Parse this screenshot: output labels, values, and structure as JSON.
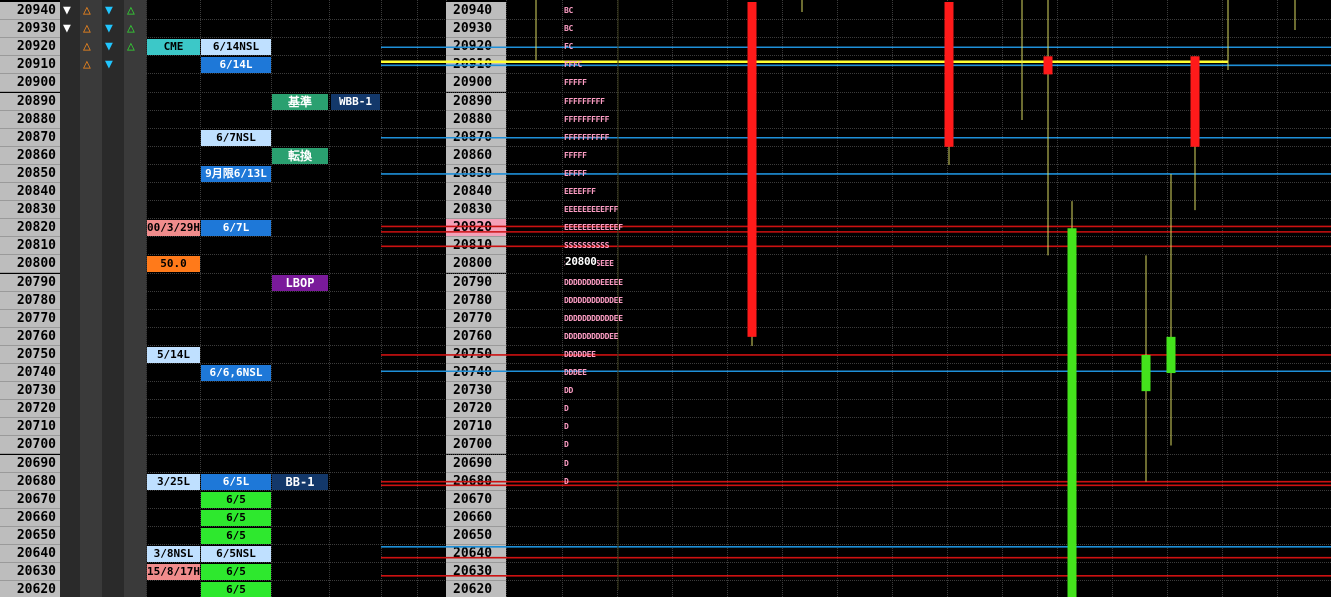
{
  "chart_data": {
    "type": "candlestick",
    "price_levels": [
      20940,
      20930,
      20920,
      20910,
      20900,
      20890,
      20880,
      20870,
      20860,
      20850,
      20840,
      20830,
      20820,
      20810,
      20800,
      20790,
      20780,
      20770,
      20760,
      20750,
      20740,
      20730,
      20720,
      20710,
      20700,
      20690,
      20680,
      20670,
      20660,
      20650,
      20640,
      20630,
      20620
    ],
    "ylim": [
      20615,
      20945
    ],
    "candles": [
      {
        "x_index": 0,
        "open": 20945,
        "close": 20760,
        "high": 20945,
        "low": 20755,
        "color": "red"
      },
      {
        "x_index": 1,
        "open": 20945,
        "close": 20865,
        "high": 20945,
        "low": 20855,
        "color": "red"
      },
      {
        "x_index": 2,
        "open": 20915,
        "close": 20905,
        "high": 20945,
        "low": 20805,
        "color": "red"
      },
      {
        "x_index": 3,
        "open": 20615,
        "close": 20820,
        "high": 20835,
        "low": 20615,
        "color": "green"
      },
      {
        "x_index": 4,
        "open": 20730,
        "close": 20750,
        "high": 20805,
        "low": 20680,
        "color": "green"
      },
      {
        "x_index": 5,
        "open": 20740,
        "close": 20760,
        "high": 20850,
        "low": 20700,
        "color": "green"
      },
      {
        "x_index": 6,
        "open": 20915,
        "close": 20865,
        "high": 20915,
        "low": 20830,
        "color": "red"
      }
    ],
    "horizontal_lines": [
      {
        "price": 20920,
        "color": "#1e8fd8"
      },
      {
        "price": 20912,
        "color": "#ffff33"
      },
      {
        "price": 20910,
        "color": "#1e8fd8"
      },
      {
        "price": 20870,
        "color": "#1e8fd8"
      },
      {
        "price": 20850,
        "color": "#1e8fd8"
      },
      {
        "price": 20821,
        "color": "#cc1111"
      },
      {
        "price": 20818,
        "color": "#cc1111"
      },
      {
        "price": 20810,
        "color": "#cc1111"
      },
      {
        "price": 20750,
        "color": "#cc1111"
      },
      {
        "price": 20741,
        "color": "#1e8fd8"
      },
      {
        "price": 20680,
        "color": "#cc1111"
      },
      {
        "price": 20678,
        "color": "#cc1111"
      },
      {
        "price": 20644,
        "color": "#1e8fd8"
      },
      {
        "price": 20638,
        "color": "#cc1111"
      },
      {
        "price": 20628,
        "color": "#cc1111"
      }
    ],
    "tpo_profile": [
      {
        "price": 20940,
        "letters": "BC"
      },
      {
        "price": 20930,
        "letters": "BC"
      },
      {
        "price": 20920,
        "letters": "FC"
      },
      {
        "price": 20910,
        "letters": "FFFC"
      },
      {
        "price": 20900,
        "letters": "FFFFF"
      },
      {
        "price": 20890,
        "letters": "FFFFFFFFF"
      },
      {
        "price": 20880,
        "letters": "FFFFFFFFFF"
      },
      {
        "price": 20870,
        "letters": "FFFFFFFFFF"
      },
      {
        "price": 20860,
        "letters": "FFFFF"
      },
      {
        "price": 20850,
        "letters": "EFFFF"
      },
      {
        "price": 20840,
        "letters": "EEEEFFF"
      },
      {
        "price": 20830,
        "letters": "EEEEEEEEEFFF"
      },
      {
        "price": 20820,
        "letters": "EEEEEEEEEEEEF"
      },
      {
        "price": 20810,
        "letters": "SSSSSSSSSS"
      },
      {
        "price": 20800,
        "letters": "SSSSSSSSEEE"
      },
      {
        "price": 20790,
        "letters": "DDDDDDDDEEEEE"
      },
      {
        "price": 20780,
        "letters": "DDDDDDDDDDDEE"
      },
      {
        "price": 20770,
        "letters": "DDDDDDDDDDDEE"
      },
      {
        "price": 20760,
        "letters": "DDDDDDDDDDEE"
      },
      {
        "price": 20750,
        "letters": "DDDDDEE"
      },
      {
        "price": 20740,
        "letters": "DDDEE"
      },
      {
        "price": 20730,
        "letters": "DD"
      },
      {
        "price": 20720,
        "letters": "D"
      },
      {
        "price": 20710,
        "letters": "D"
      },
      {
        "price": 20700,
        "letters": "D"
      },
      {
        "price": 20690,
        "letters": "D"
      },
      {
        "price": 20680,
        "letters": "D"
      }
    ],
    "tpo_highlight": {
      "price": 20800,
      "label": "20800"
    }
  },
  "arrows": [
    {
      "price": 20940,
      "col": 0,
      "glyph": "▼",
      "color": "#ffffff"
    },
    {
      "price": 20940,
      "col": 1,
      "glyph": "△",
      "color": "#ff8c1a"
    },
    {
      "price": 20940,
      "col": 2,
      "glyph": "▼",
      "color": "#21c6ff"
    },
    {
      "price": 20940,
      "col": 3,
      "glyph": "△",
      "color": "#33dd33"
    },
    {
      "price": 20930,
      "col": 0,
      "glyph": "▼",
      "color": "#ffffff"
    },
    {
      "price": 20930,
      "col": 1,
      "glyph": "△",
      "color": "#ff8c1a"
    },
    {
      "price": 20930,
      "col": 2,
      "glyph": "▼",
      "color": "#21c6ff"
    },
    {
      "price": 20930,
      "col": 3,
      "glyph": "△",
      "color": "#33dd33"
    },
    {
      "price": 20920,
      "col": 1,
      "glyph": "△",
      "color": "#ff8c1a"
    },
    {
      "price": 20920,
      "col": 2,
      "glyph": "▼",
      "color": "#21c6ff"
    },
    {
      "price": 20920,
      "col": 3,
      "glyph": "△",
      "color": "#33dd33"
    },
    {
      "price": 20910,
      "col": 1,
      "glyph": "△",
      "color": "#ff8c1a"
    },
    {
      "price": 20910,
      "col": 2,
      "glyph": "▼",
      "color": "#21c6ff"
    }
  ],
  "markers": [
    {
      "price": 20920,
      "col": "a",
      "text": "CME",
      "bg": "#3cc8c8",
      "fg": "#000000"
    },
    {
      "price": 20920,
      "col": "b",
      "text": "6/14NSL",
      "bg": "#bfe0ff",
      "fg": "#000000"
    },
    {
      "price": 20910,
      "col": "b",
      "text": "6/14L",
      "bg": "#1e78d8",
      "fg": "#ffffff"
    },
    {
      "price": 20890,
      "col": "c",
      "text": "基準",
      "bg": "#2aa070",
      "fg": "#ffffff"
    },
    {
      "price": 20890,
      "col": "d",
      "text": "WBB-1",
      "bg": "#13386a",
      "fg": "#ffffff"
    },
    {
      "price": 20870,
      "col": "b",
      "text": "6/7NSL",
      "bg": "#bfe0ff",
      "fg": "#000000"
    },
    {
      "price": 20860,
      "col": "c",
      "text": "転換",
      "bg": "#2aa070",
      "fg": "#ffffff"
    },
    {
      "price": 20850,
      "col": "b",
      "text": "9月限6/13L",
      "bg": "#1e78d8",
      "fg": "#ffffff"
    },
    {
      "price": 20820,
      "col": "a",
      "text": "00/3/29H",
      "bg": "#f08c8c",
      "fg": "#000000"
    },
    {
      "price": 20820,
      "col": "b",
      "text": "6/7L",
      "bg": "#1e78d8",
      "fg": "#ffffff"
    },
    {
      "price": 20800,
      "col": "a",
      "text": "50.0",
      "bg": "#ff7a1a",
      "fg": "#000000"
    },
    {
      "price": 20790,
      "col": "c",
      "text": "LBOP",
      "bg": "#7a1a9a",
      "fg": "#ffffff"
    },
    {
      "price": 20750,
      "col": "a",
      "text": "5/14L",
      "bg": "#bfe0ff",
      "fg": "#000000"
    },
    {
      "price": 20740,
      "col": "b",
      "text": "6/6,6NSL",
      "bg": "#1e78d8",
      "fg": "#ffffff"
    },
    {
      "price": 20680,
      "col": "a",
      "text": "3/25L",
      "bg": "#bfe0ff",
      "fg": "#000000"
    },
    {
      "price": 20680,
      "col": "b",
      "text": "6/5L",
      "bg": "#1e78d8",
      "fg": "#ffffff"
    },
    {
      "price": 20680,
      "col": "c",
      "text": "BB-1",
      "bg": "#13386a",
      "fg": "#ffffff"
    },
    {
      "price": 20670,
      "col": "b",
      "text": "6/5",
      "bg": "#2ee82e",
      "fg": "#000000"
    },
    {
      "price": 20660,
      "col": "b",
      "text": "6/5",
      "bg": "#2ee82e",
      "fg": "#000000"
    },
    {
      "price": 20650,
      "col": "b",
      "text": "6/5",
      "bg": "#2ee82e",
      "fg": "#000000"
    },
    {
      "price": 20640,
      "col": "a",
      "text": "3/8NSL",
      "bg": "#bfe0ff",
      "fg": "#000000"
    },
    {
      "price": 20640,
      "col": "b",
      "text": "6/5NSL",
      "bg": "#bfe0ff",
      "fg": "#000000"
    },
    {
      "price": 20630,
      "col": "a",
      "text": "15/8/17H",
      "bg": "#f08c8c",
      "fg": "#000000"
    },
    {
      "price": 20630,
      "col": "b",
      "text": "6/5",
      "bg": "#2ee82e",
      "fg": "#000000"
    },
    {
      "price": 20620,
      "col": "b",
      "text": "6/5",
      "bg": "#2ee82e",
      "fg": "#000000"
    }
  ],
  "highlight_price_cell": {
    "price": 20820,
    "color": "#f4a0b8"
  }
}
